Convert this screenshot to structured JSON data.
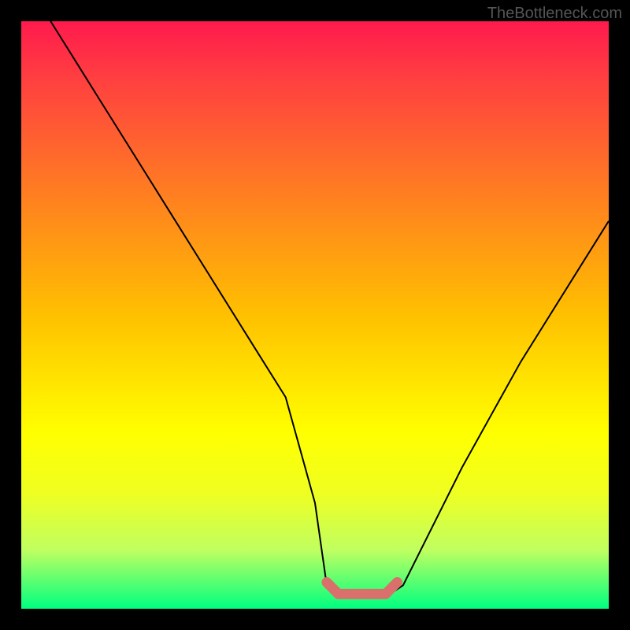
{
  "watermark": "TheBottleneck.com",
  "chart_data": {
    "type": "line",
    "title": "",
    "xlabel": "",
    "ylabel": "",
    "xlim": [
      0,
      100
    ],
    "ylim": [
      0,
      100
    ],
    "series": [
      {
        "name": "bottleneck-curve",
        "x": [
          5,
          10,
          15,
          20,
          25,
          30,
          35,
          40,
          45,
          50,
          52,
          55,
          58,
          60,
          62,
          65,
          70,
          75,
          80,
          85,
          90,
          95,
          100
        ],
        "y": [
          100,
          92,
          84,
          76,
          68,
          60,
          52,
          44,
          36,
          18,
          4,
          2,
          2,
          2,
          2,
          4,
          14,
          24,
          33,
          42,
          50,
          58,
          66
        ]
      },
      {
        "name": "optimal-range-marker",
        "x": [
          52,
          54,
          56,
          58,
          60,
          62,
          64
        ],
        "y": [
          4.5,
          2.5,
          2.5,
          2.5,
          2.5,
          2.5,
          4.5
        ]
      }
    ]
  }
}
